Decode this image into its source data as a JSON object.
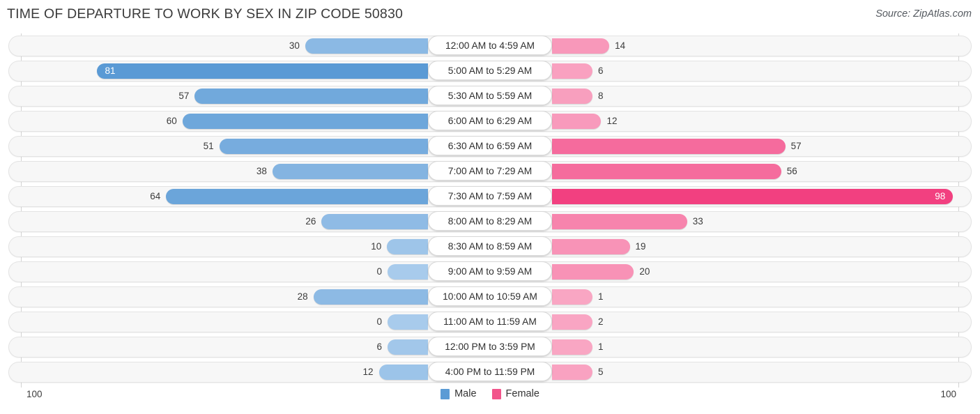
{
  "header": {
    "title": "TIME OF DEPARTURE TO WORK BY SEX IN ZIP CODE 50830",
    "source": "Source: ZipAtlas.com"
  },
  "legend": {
    "male_label": "Male",
    "female_label": "Female",
    "male_color": "#5b9bd5",
    "female_color": "#f2558b"
  },
  "axis": {
    "left_max": "100",
    "right_max": "100"
  },
  "chart_data": {
    "type": "bar",
    "title": "TIME OF DEPARTURE TO WORK BY SEX IN ZIP CODE 50830",
    "subtitle": "Source: ZipAtlas.com",
    "orientation": "horizontal-diverging",
    "xlabel": "",
    "ylabel": "",
    "xlim": [
      100,
      100
    ],
    "grid": false,
    "legend_position": "bottom-center",
    "categories": [
      "12:00 AM to 4:59 AM",
      "5:00 AM to 5:29 AM",
      "5:30 AM to 5:59 AM",
      "6:00 AM to 6:29 AM",
      "6:30 AM to 6:59 AM",
      "7:00 AM to 7:29 AM",
      "7:30 AM to 7:59 AM",
      "8:00 AM to 8:29 AM",
      "8:30 AM to 8:59 AM",
      "9:00 AM to 9:59 AM",
      "10:00 AM to 10:59 AM",
      "11:00 AM to 11:59 AM",
      "12:00 PM to 3:59 PM",
      "4:00 PM to 11:59 PM"
    ],
    "series": [
      {
        "name": "Male",
        "values": [
          30,
          81,
          57,
          60,
          51,
          38,
          64,
          26,
          10,
          0,
          28,
          0,
          6,
          12
        ]
      },
      {
        "name": "Female",
        "values": [
          14,
          6,
          8,
          12,
          57,
          56,
          98,
          33,
          19,
          20,
          1,
          2,
          1,
          5
        ]
      }
    ]
  }
}
